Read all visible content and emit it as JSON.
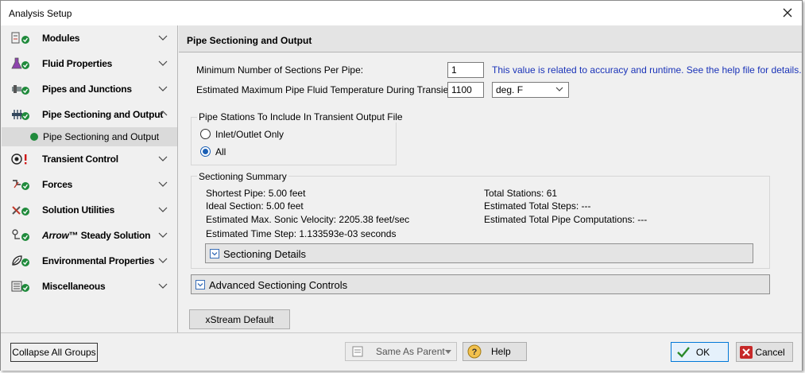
{
  "window": {
    "title": "Analysis Setup"
  },
  "sidebar": {
    "groups": [
      {
        "label": "Modules",
        "icon": "modules-icon"
      },
      {
        "label": "Fluid Properties",
        "icon": "flask-icon"
      },
      {
        "label": "Pipes and Junctions",
        "icon": "pipes-junctions-icon"
      },
      {
        "label": "Pipe Sectioning and Output",
        "icon": "pipe-sectioning-icon",
        "expanded": true,
        "children": [
          {
            "label": "Pipe Sectioning and Output",
            "selected": true
          }
        ]
      },
      {
        "label": "Transient Control",
        "icon": "transient-control-icon",
        "status": "warning"
      },
      {
        "label": "Forces",
        "icon": "forces-icon"
      },
      {
        "label": "Solution Utilities",
        "icon": "solution-utilities-icon"
      },
      {
        "label_prefix": "Arrow",
        "label_suffix": "™ Steady Solution",
        "icon": "steady-solution-icon"
      },
      {
        "label": "Environmental Properties",
        "icon": "environmental-icon"
      },
      {
        "label": "Miscellaneous",
        "icon": "miscellaneous-icon"
      }
    ]
  },
  "main": {
    "header": "Pipe Sectioning and Output",
    "min_sections_label": "Minimum Number of Sections Per Pipe:",
    "min_sections_value": "1",
    "min_sections_note": "This value is related to accuracy and runtime. See the help file for details.",
    "max_temp_label": "Estimated Maximum Pipe Fluid Temperature During Transient:",
    "max_temp_value": "1100",
    "temp_unit": "deg. F",
    "stations_group": {
      "legend": "Pipe Stations To Include In Transient Output File",
      "options": [
        "Inlet/Outlet Only",
        "All"
      ],
      "selected": "All"
    },
    "summary": {
      "legend": "Sectioning Summary",
      "shortest_pipe": "Shortest Pipe: 5.00 feet",
      "ideal_section": "Ideal Section: 5.00 feet",
      "max_sonic": "Estimated Max. Sonic Velocity: 2205.38 feet/sec",
      "time_step": "Estimated Time Step: 1.133593e-03 seconds",
      "total_stations": "Total Stations: 61",
      "total_steps": "Estimated Total Steps:  ---",
      "total_computations": "Estimated Total Pipe Computations:  ---",
      "details_label": "Sectioning Details"
    },
    "advanced_label": "Advanced Sectioning Controls",
    "xstream_button": "xStream Default"
  },
  "footer": {
    "collapse_all": "Collapse All Groups",
    "same_as_parent": "Same As Parent",
    "help": "Help",
    "ok": "OK",
    "cancel": "Cancel"
  },
  "colors": {
    "status_green": "#1f8a3b",
    "link_blue": "#1a33b8",
    "warning_red": "#d01818",
    "ok_check": "#2a8a2a",
    "cancel_red": "#c62828"
  }
}
